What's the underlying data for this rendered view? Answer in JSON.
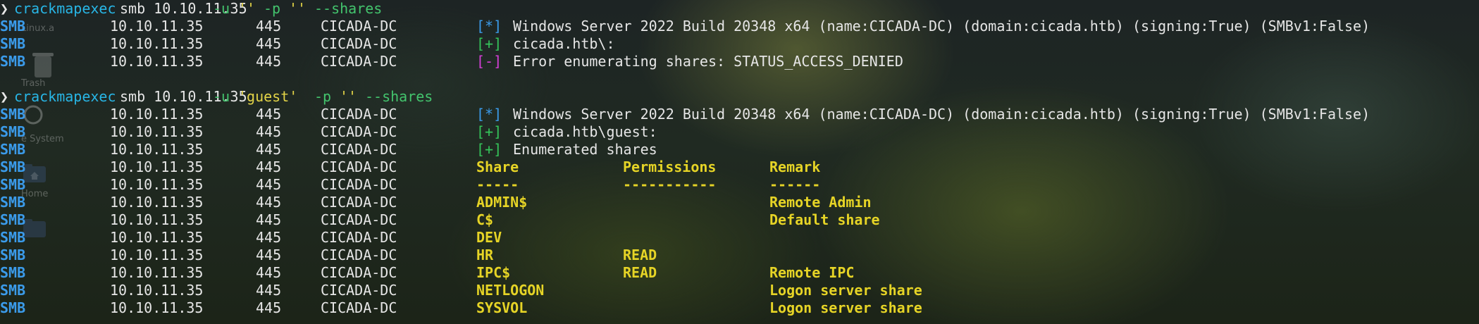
{
  "desktop": {
    "items": [
      {
        "label": "Linux.a",
        "icon": "file-icon"
      },
      {
        "label": "Trash",
        "icon": "trash-icon"
      },
      {
        "label": "e System",
        "icon": "disk-icon"
      },
      {
        "label": "Home",
        "icon": "home-folder-icon"
      }
    ]
  },
  "colors": {
    "command": "#28b6e6",
    "flag": "#43c46d",
    "string": "#e3d447",
    "smb": "#3b9bea",
    "ok": "#35c45a",
    "error": "#d53fd8",
    "share_table": "#e6d426"
  },
  "commands": [
    {
      "prompt": "❯",
      "program": "crackmapexec",
      "args": [
        "smb 10.10.11.35",
        "-u",
        "''",
        "-p",
        "''",
        "--shares"
      ],
      "rows": [
        {
          "proto": "SMB",
          "ip": "10.10.11.35",
          "port": "445",
          "host": "CICADA-DC",
          "tag": "[*]",
          "text": "Windows Server 2022 Build 20348 x64 (name:CICADA-DC) (domain:cicada.htb) (signing:True) (SMBv1:False)"
        },
        {
          "proto": "SMB",
          "ip": "10.10.11.35",
          "port": "445",
          "host": "CICADA-DC",
          "tag": "[+]",
          "text": "cicada.htb\\:"
        },
        {
          "proto": "SMB",
          "ip": "10.10.11.35",
          "port": "445",
          "host": "CICADA-DC",
          "tag": "[-]",
          "text": "Error enumerating shares: STATUS_ACCESS_DENIED"
        }
      ]
    },
    {
      "prompt": "❯",
      "program": "crackmapexec",
      "args": [
        "smb 10.10.11.35",
        "-u",
        "'guest'",
        "-p",
        "''",
        "--shares"
      ],
      "rows": [
        {
          "proto": "SMB",
          "ip": "10.10.11.35",
          "port": "445",
          "host": "CICADA-DC",
          "tag": "[*]",
          "text": "Windows Server 2022 Build 20348 x64 (name:CICADA-DC) (domain:cicada.htb) (signing:True) (SMBv1:False)"
        },
        {
          "proto": "SMB",
          "ip": "10.10.11.35",
          "port": "445",
          "host": "CICADA-DC",
          "tag": "[+]",
          "text": "cicada.htb\\guest:"
        },
        {
          "proto": "SMB",
          "ip": "10.10.11.35",
          "port": "445",
          "host": "CICADA-DC",
          "tag": "[+]",
          "text": "Enumerated shares"
        }
      ],
      "share_table": {
        "proto": "SMB",
        "ip": "10.10.11.35",
        "port": "445",
        "host": "CICADA-DC",
        "headers": [
          "Share",
          "Permissions",
          "Remark"
        ],
        "underline": [
          "-----",
          "-----------",
          "------"
        ],
        "rows": [
          [
            "ADMIN$",
            "",
            "Remote Admin"
          ],
          [
            "C$",
            "",
            "Default share"
          ],
          [
            "DEV",
            "",
            ""
          ],
          [
            "HR",
            "READ",
            ""
          ],
          [
            "IPC$",
            "READ",
            "Remote IPC"
          ],
          [
            "NETLOGON",
            "",
            "Logon server share"
          ],
          [
            "SYSVOL",
            "",
            "Logon server share"
          ]
        ]
      }
    }
  ]
}
